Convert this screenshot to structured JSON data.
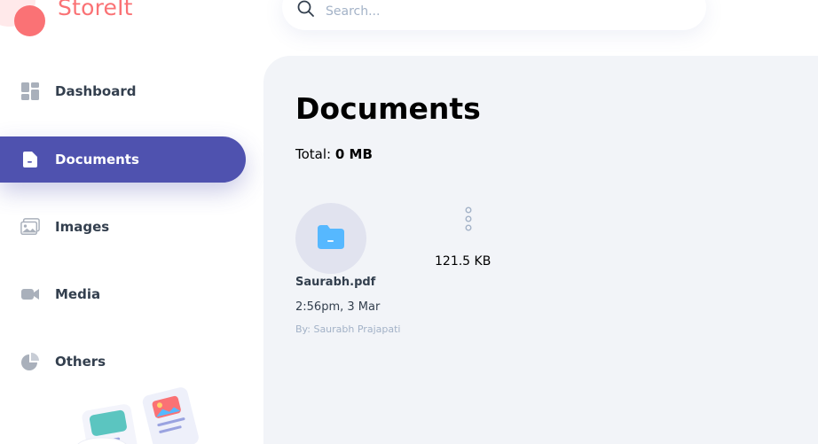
{
  "app": {
    "name": "StoreIt"
  },
  "search": {
    "placeholder": "Search..."
  },
  "sidebar": {
    "items": [
      {
        "label": "Dashboard",
        "icon": "dashboard-icon",
        "active": false
      },
      {
        "label": "Documents",
        "icon": "document-icon",
        "active": true
      },
      {
        "label": "Images",
        "icon": "image-icon",
        "active": false
      },
      {
        "label": "Media",
        "icon": "video-icon",
        "active": false
      },
      {
        "label": "Others",
        "icon": "pie-chart-icon",
        "active": false
      }
    ]
  },
  "main": {
    "title": "Documents",
    "total_label": "Total:",
    "total_value": "0 MB",
    "files": [
      {
        "name": "Saurabh.pdf",
        "size": "121.5 KB",
        "date": "2:56pm, 3 Mar",
        "owner": "By: Saurabh Prajapati",
        "icon": "folder-icon"
      }
    ]
  },
  "colors": {
    "brand": "#fa7275",
    "active_nav": "#4f52af",
    "main_bg": "#f2f4f8",
    "file_icon": "#56b8ff",
    "muted_text": "#a3b2c7"
  }
}
